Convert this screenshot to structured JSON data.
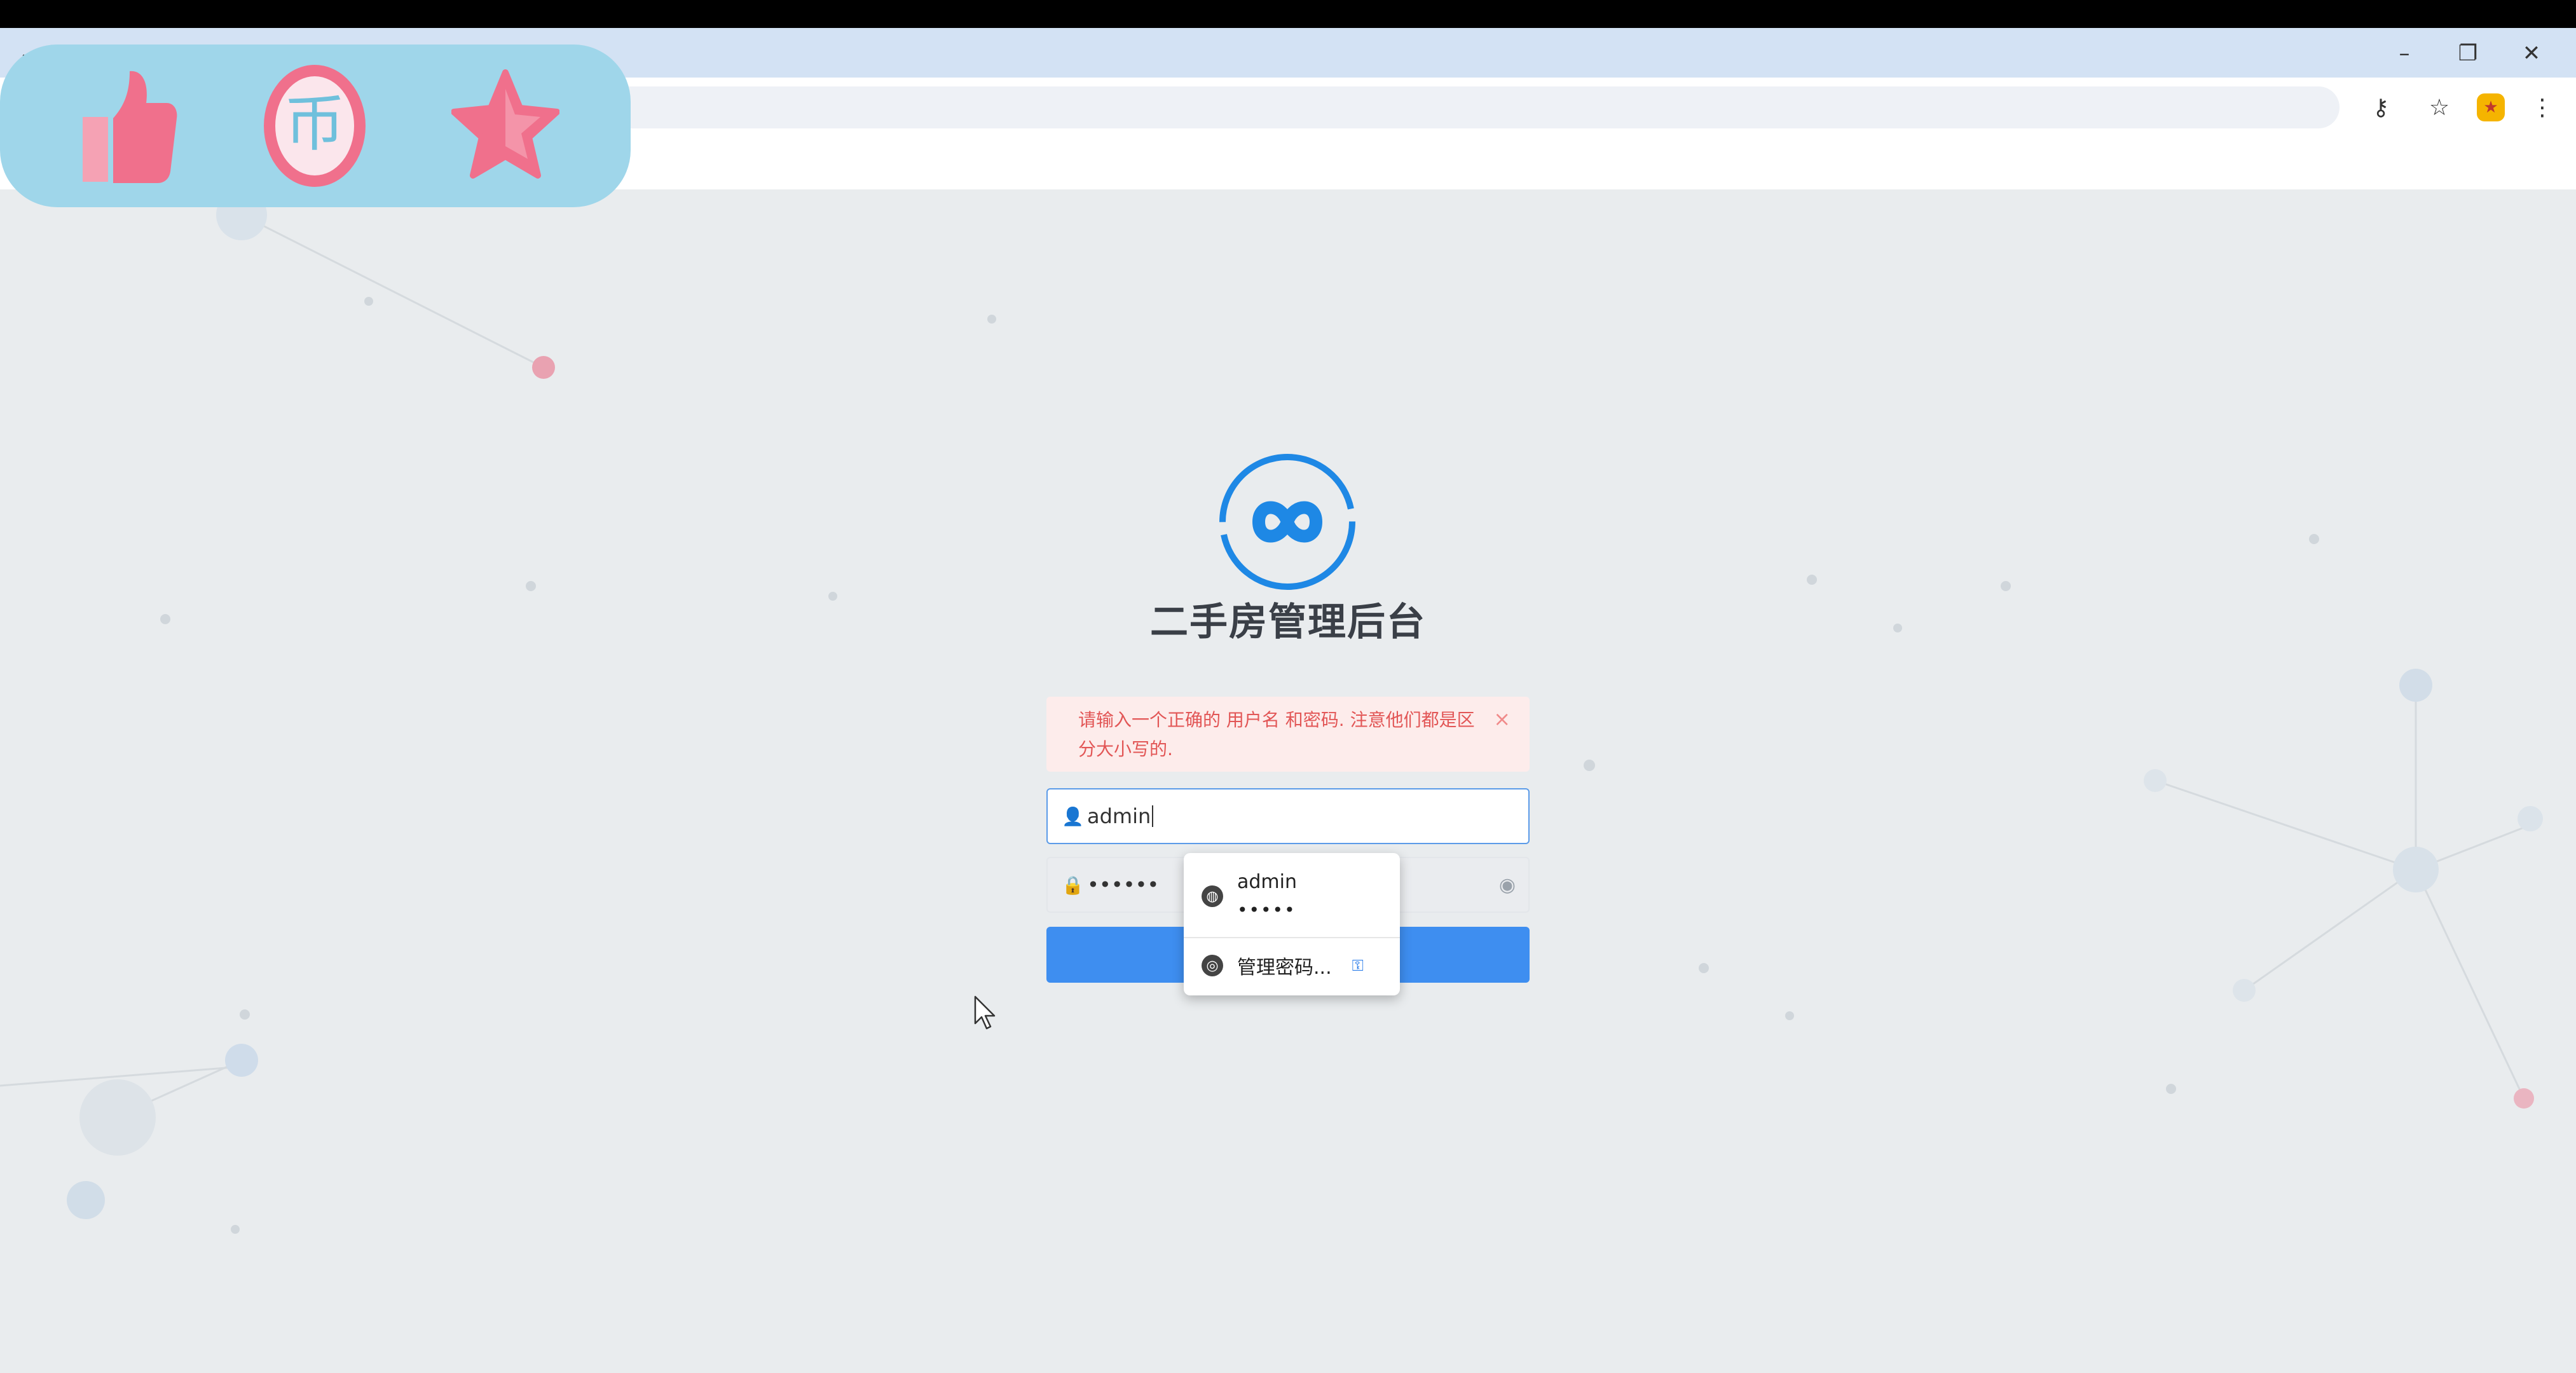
{
  "window": {
    "controls": {
      "minimize": "–",
      "restore": "❐",
      "close": "✕"
    }
  },
  "page": {
    "brand_title": "二手房管理后台",
    "alert_text": "请输入一个正确的 用户名 和密码. 注意他们都是区分大小写的.",
    "alert_close": "×",
    "username_value": "admin",
    "password_value": "••••••",
    "login_button": ""
  },
  "autofill": {
    "account_name": "admin",
    "account_password": "•••••",
    "manage_label": "管理密码..."
  },
  "icons": {
    "user": "user-icon",
    "lock": "lock-icon",
    "eye": "eye-icon",
    "key": "key-icon",
    "star": "bookmark-star-icon"
  },
  "colors": {
    "accent": "#3e8ef0",
    "alert_bg": "#fdeceb",
    "alert_text": "#e25656",
    "overlay_bg": "#9fd6ea",
    "overlay_icon": "#f0708c"
  }
}
